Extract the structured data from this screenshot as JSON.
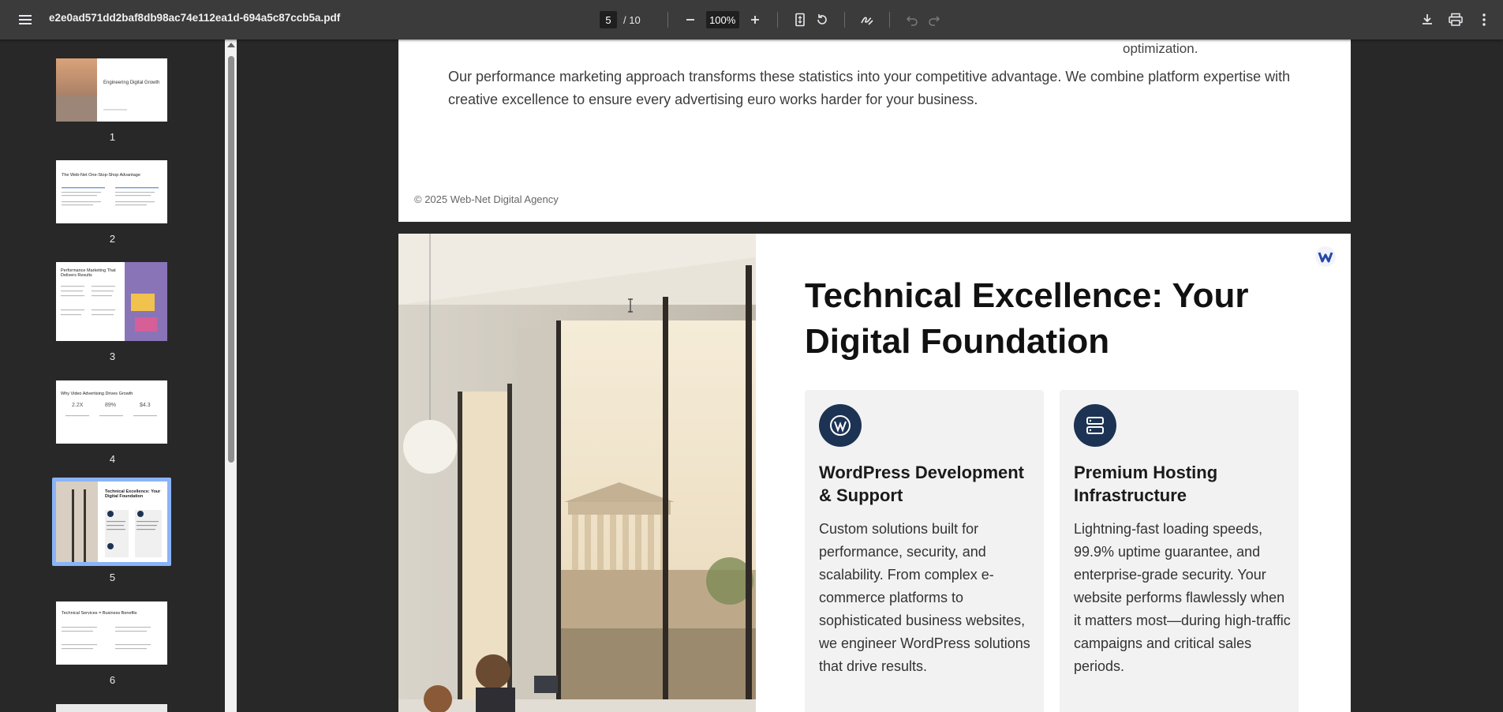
{
  "toolbar": {
    "filename": "e2e0ad571dd2baf8db98ac74e112ea1d-694a5c87ccb5a.pdf",
    "current_page": "5",
    "page_total": "/ 10",
    "zoom": "100%",
    "icons": [
      "menu-icon",
      "zoom-out-icon",
      "zoom-in-icon",
      "fit-page-icon",
      "rotate-icon",
      "annotate-icon",
      "undo-icon",
      "redo-icon",
      "download-icon",
      "print-icon",
      "more-icon"
    ]
  },
  "sidebar": {
    "thumbnails": [
      {
        "num": "1",
        "title": "Engineering Digital Growth"
      },
      {
        "num": "2",
        "title": "The Web-Net One-Stop-Shop Advantage"
      },
      {
        "num": "3",
        "title": "Performance Marketing That Delivers Results"
      },
      {
        "num": "4",
        "title": "Why Video Advertising Drives Growth",
        "stats": [
          "2.2X",
          "89%",
          "$4.3"
        ]
      },
      {
        "num": "5",
        "title": "Technical Excellence: Your Digital Foundation"
      },
      {
        "num": "6",
        "title": "Technical Services = Business Benefits"
      }
    ],
    "selected": "5"
  },
  "page4": {
    "fragment": "optimization.",
    "paragraph": "Our performance marketing approach transforms these statistics into your competitive advantage. We combine platform expertise with creative excellence to ensure every advertising euro works harder for your business.",
    "footer": "© 2025 Web-Net Digital Agency"
  },
  "page5": {
    "title": "Technical Excellence: Your Digital Foundation",
    "cards": [
      {
        "icon": "wordpress-icon",
        "title": "WordPress Development & Support",
        "body": "Custom solutions built for performance, security, and scalability. From complex e-commerce platforms to sophisticated business websites, we engineer WordPress solutions that drive results."
      },
      {
        "icon": "server-icon",
        "title": "Premium Hosting Infrastructure",
        "body": "Lightning-fast loading speeds, 99.9% uptime guarantee, and enterprise-grade security. Your website performs flawlessly when it matters most—during high-traffic campaigns and critical sales periods."
      }
    ]
  },
  "colors": {
    "toolbar_bg": "#3b3b3c",
    "viewer_bg": "#282828",
    "accent_selected": "#8ab4f8",
    "card_icon_bg": "#1d3354"
  }
}
